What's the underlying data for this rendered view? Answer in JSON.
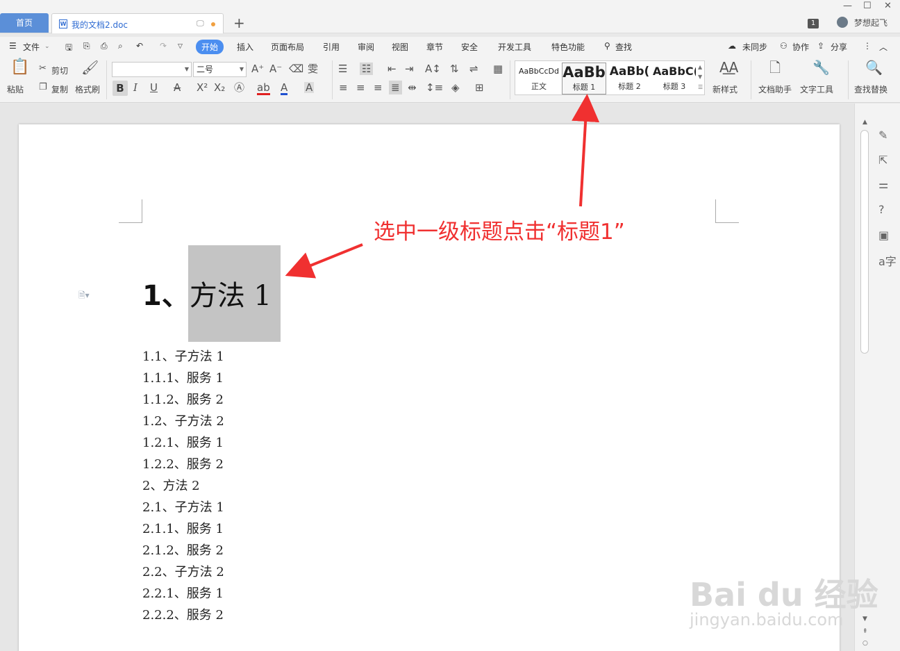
{
  "tabs": {
    "home": "首页",
    "document": "我的文档2.doc",
    "new_tab": "+"
  },
  "window": {
    "minimize": "—",
    "restore": "☐",
    "close": "✕",
    "page_count": "1",
    "user_name": "梦想起飞"
  },
  "menu": {
    "file": "文件",
    "items": [
      "开始",
      "插入",
      "页面布局",
      "引用",
      "审阅",
      "视图",
      "章节",
      "安全",
      "开发工具",
      "特色功能"
    ],
    "search": "查找",
    "sync": "未同步",
    "collab": "协作",
    "share": "分享"
  },
  "ribbon": {
    "paste": "粘贴",
    "cut": "剪切",
    "copy": "复制",
    "format_painter": "格式刷",
    "font_name": "",
    "font_size": "二号",
    "styles": [
      {
        "preview": "AaBbCcDd",
        "label": "正文"
      },
      {
        "preview": "AaBb",
        "label": "标题 1"
      },
      {
        "preview": "AaBb(",
        "label": "标题 2"
      },
      {
        "preview": "AaBbC(",
        "label": "标题 3"
      }
    ],
    "new_style": "新样式",
    "doc_assistant": "文档助手",
    "text_tools": "文字工具",
    "find_replace": "查找替换"
  },
  "document": {
    "heading_num": "1、",
    "heading_text": "方法 1",
    "outline": [
      "1.1、子方法 1",
      "1.1.1、服务 1",
      "1.1.2、服务 2",
      "1.2、子方法 2",
      "1.2.1、服务 1",
      "1.2.2、服务 2",
      "2、方法 2",
      "2.1、子方法 1",
      "2.1.1、服务 1",
      "2.1.2、服务 2",
      "2.2、子方法 2",
      "2.2.1、服务 1",
      "2.2.2、服务 2"
    ]
  },
  "annotation": {
    "text": "选中一级标题点击“标题1”",
    "color": "#f03030"
  },
  "watermark": {
    "brand": "Bai du 经验",
    "url": "jingyan.baidu.com"
  },
  "colors": {
    "accent": "#4b8ef0",
    "home_tab": "#5b8fd8",
    "selection": "#c4c4c4"
  }
}
